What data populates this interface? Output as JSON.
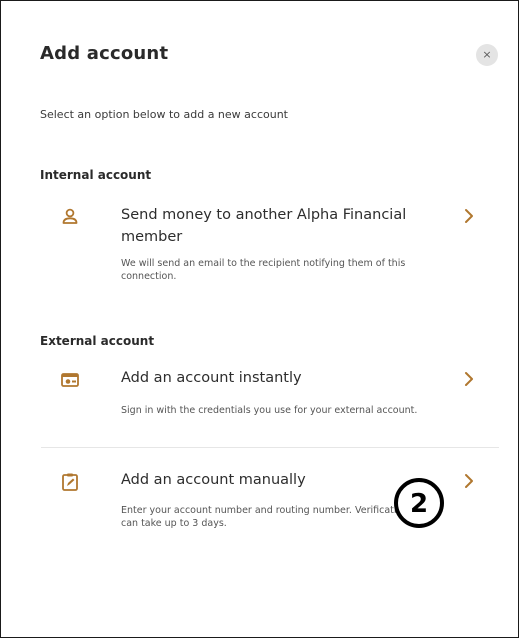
{
  "dialog": {
    "title": "Add account",
    "close_label": "×",
    "subtitle": "Select an option below to add a new account"
  },
  "sections": [
    {
      "title": "Internal account",
      "options": [
        {
          "icon": "person-icon",
          "label": "Send money to another Alpha Financial member",
          "description": "We will send an email to the recipient notifying them of this connection."
        }
      ]
    },
    {
      "title": "External account",
      "options": [
        {
          "icon": "bank-card-icon",
          "label": "Add an account instantly",
          "description": "Sign in with the credentials you use for your external account."
        },
        {
          "icon": "clipboard-edit-icon",
          "label": "Add an account manually",
          "description": "Enter your account number and routing number. Verification can take up to 3 days."
        }
      ]
    }
  ],
  "annotation": {
    "step_number": "2"
  },
  "colors": {
    "accent": "#b0772f",
    "text": "#2d2d2d",
    "badge_border": "#000000"
  }
}
